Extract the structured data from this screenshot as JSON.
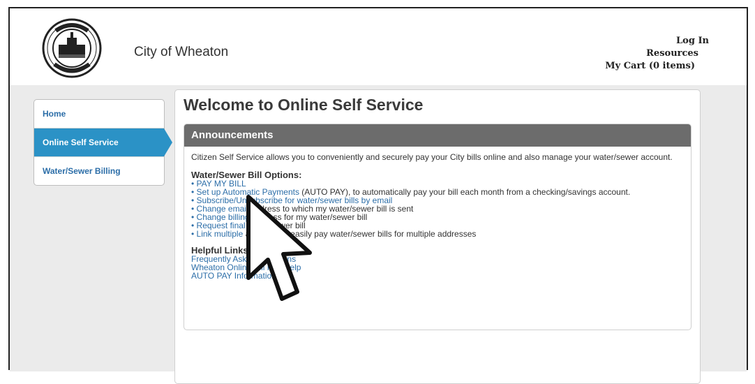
{
  "header": {
    "city_name": "City of Wheaton",
    "links": [
      "Log In",
      "Resources",
      "My Cart (0 items)"
    ]
  },
  "sidebar": {
    "items": [
      {
        "label": "Home",
        "active": false
      },
      {
        "label": "Online Self Service",
        "active": true
      },
      {
        "label": "Water/Sewer Billing",
        "active": false
      }
    ]
  },
  "main": {
    "title": "Welcome to Online Self Service",
    "panel_title": "Announcements",
    "intro": "Citizen Self Service allows you to conveniently and securely pay your City bills online and also manage your water/sewer account.",
    "options_title": "Water/Sewer Bill Options:",
    "options": [
      {
        "link": "PAY MY BILL",
        "plain": ""
      },
      {
        "link": "Set up Automatic Payments",
        "plain": " (AUTO PAY), to automatically pay your bill each month from a checking/savings account."
      },
      {
        "link": "Subscribe/Unsubscribe for water/sewer bills by email",
        "plain": ""
      },
      {
        "link": "Change email",
        "plain": " address to which my water/sewer bill is sent"
      },
      {
        "link": "Change billing",
        "plain": " address for my water/sewer bill"
      },
      {
        "link": "Request final",
        "plain": " water/sewer bill"
      },
      {
        "link": "Link multiple",
        "plain": " accounts to easily pay water/sewer bills for multiple addresses"
      }
    ],
    "helpful_title": "Helpful Links",
    "helpful_links": [
      "Frequently Asked Questions",
      "Wheaton Online Bill Pay Help",
      "AUTO PAY Information"
    ]
  },
  "icons": {
    "seal": "city-seal-icon",
    "cursor": "mouse-pointer-icon"
  }
}
